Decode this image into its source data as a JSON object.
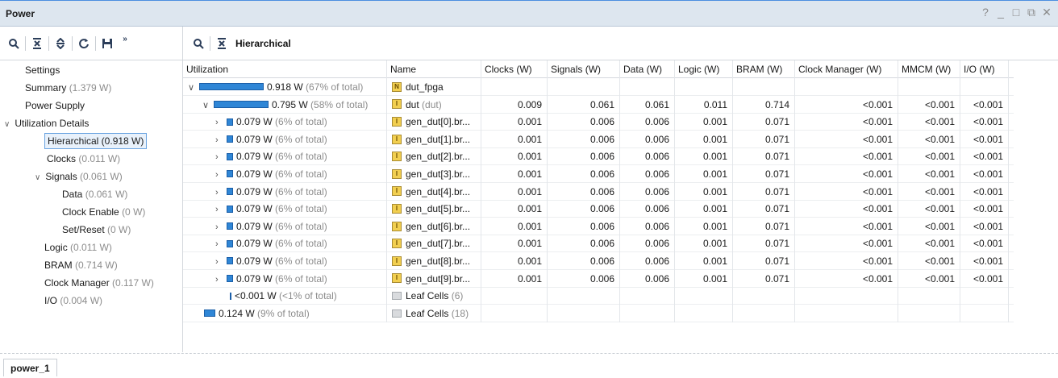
{
  "window": {
    "title": "Power",
    "controls": [
      "?",
      "_",
      "□",
      "⧉",
      "✕"
    ]
  },
  "left_toolbar": {
    "icons": [
      "search-icon",
      "collapse-all-icon",
      "expand-all-icon",
      "refresh-icon",
      "save-icon",
      "more-icon"
    ]
  },
  "right_toolbar": {
    "icons": [
      "search-icon",
      "collapse-all-icon"
    ],
    "label": "Hierarchical"
  },
  "nav": {
    "settings": "Settings",
    "summary": {
      "label": "Summary",
      "value": "(1.379 W)"
    },
    "power_supply": "Power Supply",
    "utilization_details": "Utilization Details",
    "hierarchical": "Hierarchical (0.918 W)",
    "clocks": {
      "label": "Clocks",
      "value": "(0.011 W)"
    },
    "signals": {
      "label": "Signals",
      "value": "(0.061 W)"
    },
    "data": {
      "label": "Data",
      "value": "(0.061 W)"
    },
    "clock_enable": {
      "label": "Clock Enable",
      "value": "(0 W)"
    },
    "set_reset": {
      "label": "Set/Reset",
      "value": "(0 W)"
    },
    "logic": {
      "label": "Logic",
      "value": "(0.011 W)"
    },
    "bram": {
      "label": "BRAM",
      "value": "(0.714 W)"
    },
    "clock_manager": {
      "label": "Clock Manager",
      "value": "(0.117 W)"
    },
    "io": {
      "label": "I/O",
      "value": "(0.004 W)"
    }
  },
  "table": {
    "headers": [
      "Utilization",
      "Name",
      "Clocks (W)",
      "Signals (W)",
      "Data (W)",
      "Logic (W)",
      "BRAM (W)",
      "Clock Manager (W)",
      "MMCM (W)",
      "I/O (W)"
    ],
    "rows": [
      {
        "util": "0.918 W",
        "pct": "(67% of total)",
        "name": "dut_fpga",
        "name_extra": "",
        "vals": [
          "",
          "",
          "",
          "",
          "",
          "",
          "",
          ""
        ]
      },
      {
        "util": "0.795 W",
        "pct": "(58% of total)",
        "name": "dut",
        "name_extra": "(dut)",
        "vals": [
          "0.009",
          "0.061",
          "0.061",
          "0.011",
          "0.714",
          "<0.001",
          "<0.001",
          "<0.001"
        ]
      },
      {
        "util": "0.079 W",
        "pct": "(6% of total)",
        "name": "gen_dut[0].br...",
        "name_extra": "",
        "vals": [
          "0.001",
          "0.006",
          "0.006",
          "0.001",
          "0.071",
          "<0.001",
          "<0.001",
          "<0.001"
        ]
      },
      {
        "util": "0.079 W",
        "pct": "(6% of total)",
        "name": "gen_dut[1].br...",
        "name_extra": "",
        "vals": [
          "0.001",
          "0.006",
          "0.006",
          "0.001",
          "0.071",
          "<0.001",
          "<0.001",
          "<0.001"
        ]
      },
      {
        "util": "0.079 W",
        "pct": "(6% of total)",
        "name": "gen_dut[2].br...",
        "name_extra": "",
        "vals": [
          "0.001",
          "0.006",
          "0.006",
          "0.001",
          "0.071",
          "<0.001",
          "<0.001",
          "<0.001"
        ]
      },
      {
        "util": "0.079 W",
        "pct": "(6% of total)",
        "name": "gen_dut[3].br...",
        "name_extra": "",
        "vals": [
          "0.001",
          "0.006",
          "0.006",
          "0.001",
          "0.071",
          "<0.001",
          "<0.001",
          "<0.001"
        ]
      },
      {
        "util": "0.079 W",
        "pct": "(6% of total)",
        "name": "gen_dut[4].br...",
        "name_extra": "",
        "vals": [
          "0.001",
          "0.006",
          "0.006",
          "0.001",
          "0.071",
          "<0.001",
          "<0.001",
          "<0.001"
        ]
      },
      {
        "util": "0.079 W",
        "pct": "(6% of total)",
        "name": "gen_dut[5].br...",
        "name_extra": "",
        "vals": [
          "0.001",
          "0.006",
          "0.006",
          "0.001",
          "0.071",
          "<0.001",
          "<0.001",
          "<0.001"
        ]
      },
      {
        "util": "0.079 W",
        "pct": "(6% of total)",
        "name": "gen_dut[6].br...",
        "name_extra": "",
        "vals": [
          "0.001",
          "0.006",
          "0.006",
          "0.001",
          "0.071",
          "<0.001",
          "<0.001",
          "<0.001"
        ]
      },
      {
        "util": "0.079 W",
        "pct": "(6% of total)",
        "name": "gen_dut[7].br...",
        "name_extra": "",
        "vals": [
          "0.001",
          "0.006",
          "0.006",
          "0.001",
          "0.071",
          "<0.001",
          "<0.001",
          "<0.001"
        ]
      },
      {
        "util": "0.079 W",
        "pct": "(6% of total)",
        "name": "gen_dut[8].br...",
        "name_extra": "",
        "vals": [
          "0.001",
          "0.006",
          "0.006",
          "0.001",
          "0.071",
          "<0.001",
          "<0.001",
          "<0.001"
        ]
      },
      {
        "util": "0.079 W",
        "pct": "(6% of total)",
        "name": "gen_dut[9].br...",
        "name_extra": "",
        "vals": [
          "0.001",
          "0.006",
          "0.006",
          "0.001",
          "0.071",
          "<0.001",
          "<0.001",
          "<0.001"
        ]
      },
      {
        "util": "<0.001 W",
        "pct": "(<1% of total)",
        "name": "Leaf Cells",
        "name_extra": "(6)",
        "vals": [
          "",
          "",
          "",
          "",
          "",
          "",
          "",
          ""
        ]
      },
      {
        "util": "0.124 W",
        "pct": "(9% of total)",
        "name": "Leaf Cells",
        "name_extra": "(18)",
        "vals": [
          "",
          "",
          "",
          "",
          "",
          "",
          "",
          ""
        ]
      }
    ]
  },
  "status": {
    "tab": "power_1"
  }
}
